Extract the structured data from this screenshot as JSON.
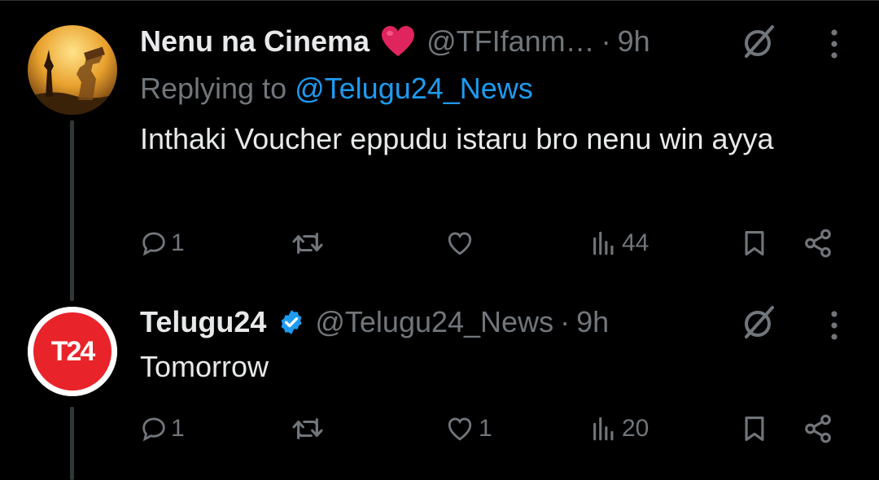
{
  "tweets": [
    {
      "author_name": "Nenu na Cinema",
      "author_emoji": "heart-emoji",
      "handle": "@TFIfanm…",
      "time": "9h",
      "dot": "·",
      "replying_prefix": "Replying to ",
      "replying_mention": "@Telugu24_News",
      "text": "Inthaki Voucher eppudu istaru bro nenu win ayya",
      "replies": "1",
      "retweets": "",
      "likes": "",
      "views": "44"
    },
    {
      "author_name": "Telugu24",
      "verified": true,
      "avatar_text": "T24",
      "handle": "@Telugu24_News",
      "time": "9h",
      "dot": "·",
      "text": "Tomorrow",
      "replies": "1",
      "retweets": "",
      "likes": "1",
      "views": "20"
    }
  ],
  "colors": {
    "background": "#000000",
    "text": "#e7e9ea",
    "secondary": "#71767b",
    "link": "#1d9bf0",
    "verified": "#1d9bf0",
    "t24_red": "#e8232a",
    "heart": "#e0245e"
  }
}
